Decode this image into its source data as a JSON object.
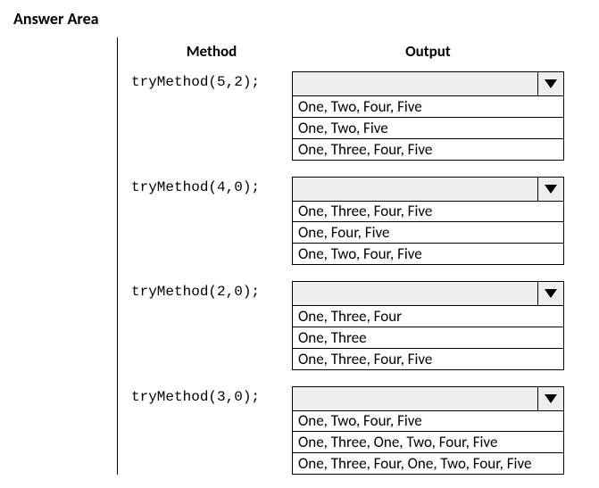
{
  "title": "Answer Area",
  "headers": {
    "method": "Method",
    "output": "Output"
  },
  "rows": [
    {
      "method": "tryMethod(5,2);",
      "options": [
        "One, Two, Four, Five",
        "One, Two, Five",
        "One, Three, Four, Five"
      ]
    },
    {
      "method": "tryMethod(4,0);",
      "options": [
        "One, Three, Four, Five",
        "One, Four, Five",
        "One, Two, Four, Five"
      ]
    },
    {
      "method": "tryMethod(2,0);",
      "options": [
        "One, Three, Four",
        "One, Three",
        "One, Three, Four, Five"
      ]
    },
    {
      "method": "tryMethod(3,0);",
      "options": [
        "One, Two, Four, Five",
        "One, Three, One, Two, Four, Five",
        "One, Three, Four, One, Two, Four, Five"
      ]
    }
  ]
}
